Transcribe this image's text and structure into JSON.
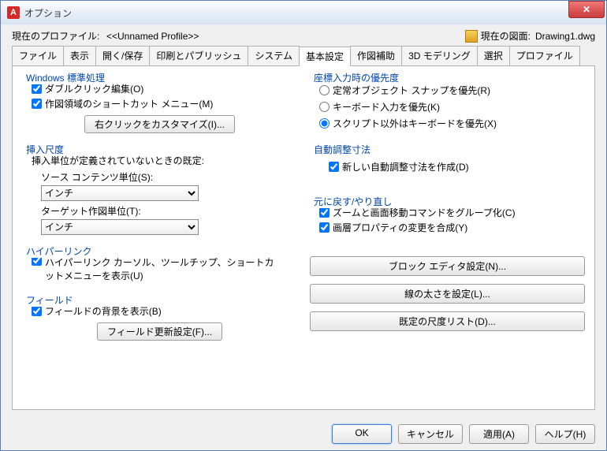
{
  "window": {
    "title": "オプション"
  },
  "profile": {
    "current_label": "現在のプロファイル:",
    "current_value": "<<Unnamed Profile>>",
    "drawing_label": "現在の図面:",
    "drawing_value": "Drawing1.dwg"
  },
  "tabs": [
    "ファイル",
    "表示",
    "開く/保存",
    "印刷とパブリッシュ",
    "システム",
    "基本設定",
    "作図補助",
    "3D モデリング",
    "選択",
    "プロファイル"
  ],
  "active_tab_index": 5,
  "left": {
    "g1": {
      "title": "Windows 標準処理",
      "chk1": "ダブルクリック編集(O)",
      "chk2": "作図領域のショートカット メニュー(M)",
      "btn": "右クリックをカスタマイズ(I)..."
    },
    "g2": {
      "title": "挿入尺度",
      "desc": "挿入単位が定義されていないときの既定:",
      "src_label": "ソース コンテンツ単位(S):",
      "src_value": "インチ",
      "tgt_label": "ターゲット作図単位(T):",
      "tgt_value": "インチ"
    },
    "g3": {
      "title": "ハイパーリンク",
      "chk": "ハイパーリンク カーソル、ツールチップ、ショートカットメニューを表示(U)"
    },
    "g4": {
      "title": "フィールド",
      "chk": "フィールドの背景を表示(B)",
      "btn": "フィールド更新設定(F)..."
    }
  },
  "right": {
    "g1": {
      "title": "座標入力時の優先度",
      "r1": "定常オブジェクト スナップを優先(R)",
      "r2": "キーボード入力を優先(K)",
      "r3": "スクリプト以外はキーボードを優先(X)"
    },
    "g2": {
      "title": "自動調整寸法",
      "chk": "新しい自動調整寸法を作成(D)"
    },
    "g3": {
      "title": "元に戻す/やり直し",
      "chk1": "ズームと画面移動コマンドをグループ化(C)",
      "chk2": "画層プロパティの変更を合成(Y)"
    },
    "btn1": "ブロック エディタ設定(N)...",
    "btn2": "線の太さを設定(L)...",
    "btn3": "既定の尺度リスト(D)..."
  },
  "footer": {
    "ok": "OK",
    "cancel": "キャンセル",
    "apply": "適用(A)",
    "help": "ヘルプ(H)"
  }
}
